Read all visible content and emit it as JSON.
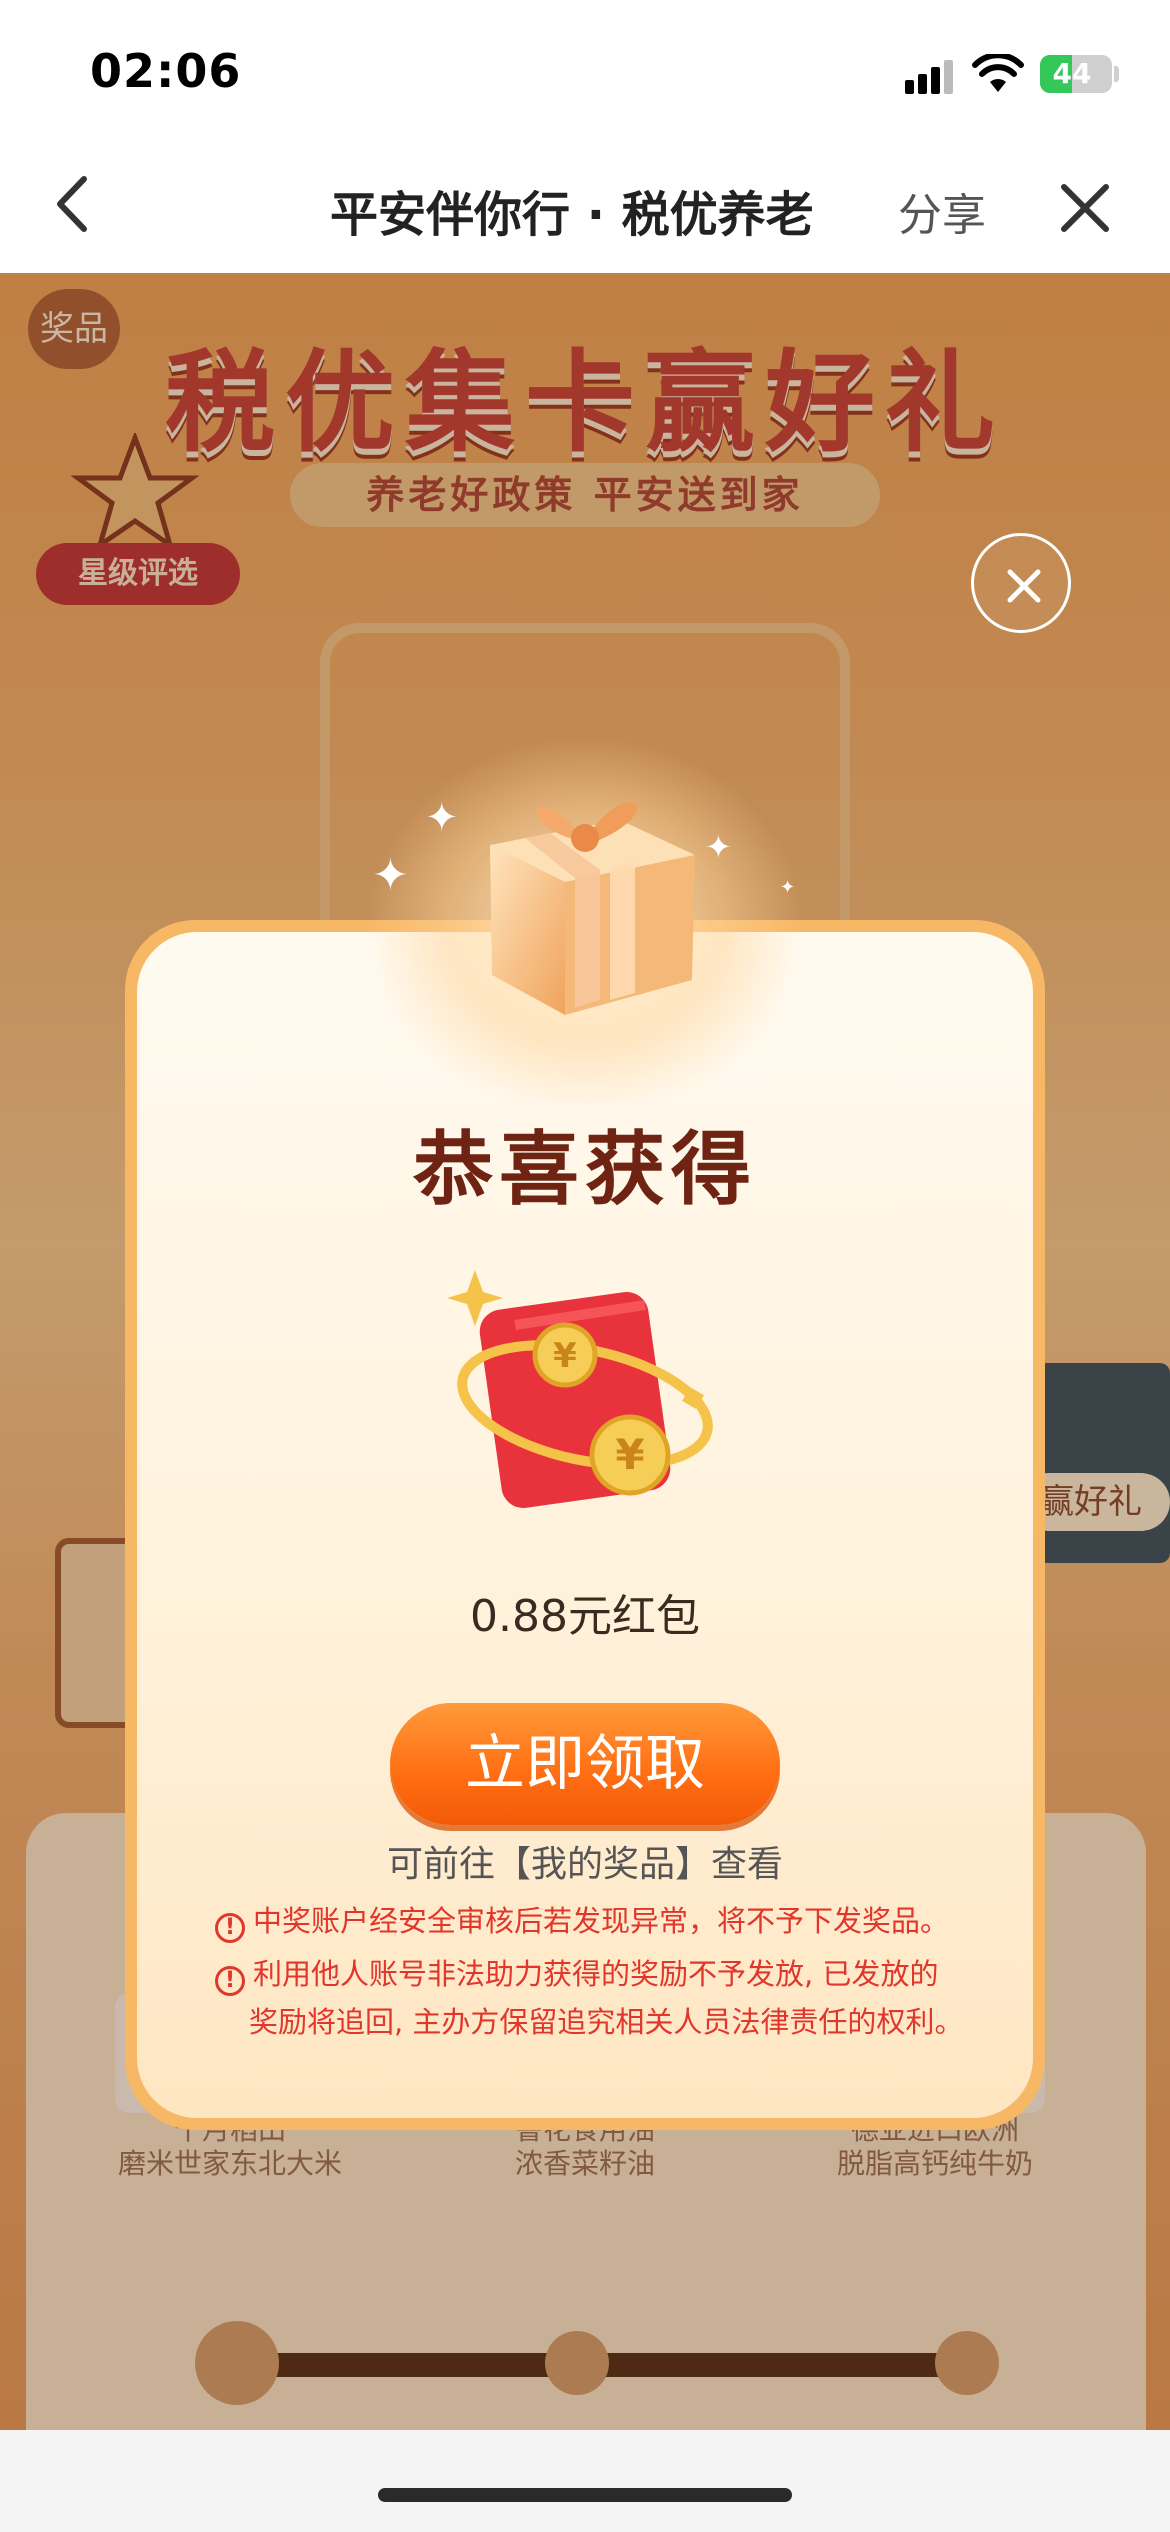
{
  "status_bar": {
    "time": "02:06",
    "battery": "44"
  },
  "nav": {
    "title": "平安伴你行 · 税优养老",
    "share_label": "分享"
  },
  "background": {
    "prize_badge": "奖品",
    "headline": "税优集卡赢好礼",
    "subtitle": "养老好政策 平安送到家",
    "star_label": "星级评选",
    "side_label": "赢好礼",
    "products": [
      {
        "line1": "十月稻田",
        "line2": "磨米世家东北大米"
      },
      {
        "line1": "鲁花食用油",
        "line2": "浓香菜籽油"
      },
      {
        "line1": "德亚进口欧洲",
        "line2": "脱脂高钙纯牛奶"
      }
    ]
  },
  "modal": {
    "title": "恭喜获得",
    "prize": "0.88元红包",
    "claim_button": "立即领取",
    "hint": "可前往【我的奖品】查看",
    "warning_1": "中奖账户经安全审核后若发现异常，将不予下发奖品。",
    "warning_2_line1": "利用他人账号非法助力获得的奖励不予发放, 已发放的",
    "warning_2_line2": "奖励将追回, 主办方保留追究相关人员法律责任的权利。",
    "warn_icon_glyph": "!"
  },
  "colors": {
    "accent": "#ff6d12",
    "title": "#6f2413",
    "warning": "#e0362b"
  }
}
